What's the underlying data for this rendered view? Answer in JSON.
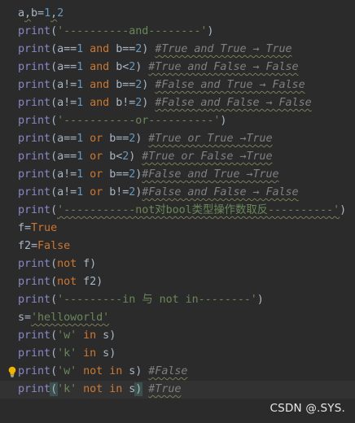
{
  "editor": {
    "lines": [
      {
        "tokens": [
          {
            "t": "plain",
            "v": "a"
          },
          {
            "t": "plain",
            "v": ",",
            "sq": true
          },
          {
            "t": "plain",
            "v": "b="
          },
          {
            "t": "num",
            "v": "1"
          },
          {
            "t": "plain",
            "v": ",",
            "sq": true
          },
          {
            "t": "num",
            "v": "2"
          }
        ]
      },
      {
        "tokens": [
          {
            "t": "builtin",
            "v": "print"
          },
          {
            "t": "plain",
            "v": "("
          },
          {
            "t": "str",
            "v": "'----------and--------'"
          },
          {
            "t": "plain",
            "v": ")"
          }
        ]
      },
      {
        "tokens": [
          {
            "t": "builtin",
            "v": "print"
          },
          {
            "t": "plain",
            "v": "(a=="
          },
          {
            "t": "num",
            "v": "1"
          },
          {
            "t": "plain",
            "v": " "
          },
          {
            "t": "kw",
            "v": "and"
          },
          {
            "t": "plain",
            "v": " b=="
          },
          {
            "t": "num",
            "v": "2"
          },
          {
            "t": "plain",
            "v": ")"
          },
          {
            "t": "plain",
            "v": " "
          },
          {
            "t": "comment",
            "v": "#True and True → True",
            "sq": true
          }
        ]
      },
      {
        "tokens": [
          {
            "t": "builtin",
            "v": "print"
          },
          {
            "t": "plain",
            "v": "(a=="
          },
          {
            "t": "num",
            "v": "1"
          },
          {
            "t": "plain",
            "v": " "
          },
          {
            "t": "kw",
            "v": "and"
          },
          {
            "t": "plain",
            "v": " b<"
          },
          {
            "t": "num",
            "v": "2"
          },
          {
            "t": "plain",
            "v": ")"
          },
          {
            "t": "plain",
            "v": " "
          },
          {
            "t": "comment",
            "v": "#True and False → False",
            "sq": true
          }
        ]
      },
      {
        "tokens": [
          {
            "t": "builtin",
            "v": "print"
          },
          {
            "t": "plain",
            "v": "(a!="
          },
          {
            "t": "num",
            "v": "1"
          },
          {
            "t": "plain",
            "v": " "
          },
          {
            "t": "kw",
            "v": "and"
          },
          {
            "t": "plain",
            "v": " b=="
          },
          {
            "t": "num",
            "v": "2"
          },
          {
            "t": "plain",
            "v": ")"
          },
          {
            "t": "plain",
            "v": " "
          },
          {
            "t": "comment",
            "v": "#False and True → False",
            "sq": true
          }
        ]
      },
      {
        "tokens": [
          {
            "t": "builtin",
            "v": "print"
          },
          {
            "t": "plain",
            "v": "(a!="
          },
          {
            "t": "num",
            "v": "1"
          },
          {
            "t": "plain",
            "v": " "
          },
          {
            "t": "kw",
            "v": "and"
          },
          {
            "t": "plain",
            "v": " b!="
          },
          {
            "t": "num",
            "v": "2"
          },
          {
            "t": "plain",
            "v": ")"
          },
          {
            "t": "plain",
            "v": " "
          },
          {
            "t": "comment",
            "v": "#False and False → False",
            "sq": true
          }
        ]
      },
      {
        "tokens": [
          {
            "t": "builtin",
            "v": "print"
          },
          {
            "t": "plain",
            "v": "("
          },
          {
            "t": "str",
            "v": "'-----------or----------'"
          },
          {
            "t": "plain",
            "v": ")"
          }
        ]
      },
      {
        "tokens": [
          {
            "t": "builtin",
            "v": "print"
          },
          {
            "t": "plain",
            "v": "(a=="
          },
          {
            "t": "num",
            "v": "1"
          },
          {
            "t": "plain",
            "v": " "
          },
          {
            "t": "kw",
            "v": "or"
          },
          {
            "t": "plain",
            "v": " b=="
          },
          {
            "t": "num",
            "v": "2"
          },
          {
            "t": "plain",
            "v": ")"
          },
          {
            "t": "plain",
            "v": " "
          },
          {
            "t": "comment",
            "v": "#True or True →True",
            "sq": true
          }
        ]
      },
      {
        "tokens": [
          {
            "t": "builtin",
            "v": "print"
          },
          {
            "t": "plain",
            "v": "(a=="
          },
          {
            "t": "num",
            "v": "1"
          },
          {
            "t": "plain",
            "v": " "
          },
          {
            "t": "kw",
            "v": "or"
          },
          {
            "t": "plain",
            "v": " b<"
          },
          {
            "t": "num",
            "v": "2"
          },
          {
            "t": "plain",
            "v": ")"
          },
          {
            "t": "plain",
            "v": " "
          },
          {
            "t": "comment",
            "v": "#True or False →True",
            "sq": true
          }
        ]
      },
      {
        "tokens": [
          {
            "t": "builtin",
            "v": "print"
          },
          {
            "t": "plain",
            "v": "(a!="
          },
          {
            "t": "num",
            "v": "1"
          },
          {
            "t": "plain",
            "v": " "
          },
          {
            "t": "kw",
            "v": "or"
          },
          {
            "t": "plain",
            "v": " b=="
          },
          {
            "t": "num",
            "v": "2"
          },
          {
            "t": "plain",
            "v": ")"
          },
          {
            "t": "comment",
            "v": "#False and True →True",
            "sq": true
          }
        ]
      },
      {
        "tokens": [
          {
            "t": "builtin",
            "v": "print"
          },
          {
            "t": "plain",
            "v": "(a!="
          },
          {
            "t": "num",
            "v": "1"
          },
          {
            "t": "plain",
            "v": " "
          },
          {
            "t": "kw",
            "v": "or"
          },
          {
            "t": "plain",
            "v": " b!="
          },
          {
            "t": "num",
            "v": "2"
          },
          {
            "t": "plain",
            "v": ")"
          },
          {
            "t": "comment",
            "v": "#False and False → False",
            "sq": true
          }
        ]
      },
      {
        "tokens": [
          {
            "t": "builtin",
            "v": "print"
          },
          {
            "t": "plain",
            "v": "("
          },
          {
            "t": "str",
            "v": "'-----------not对bool类型操作数取反----------'",
            "sq": true
          },
          {
            "t": "plain",
            "v": ")"
          }
        ]
      },
      {
        "tokens": [
          {
            "t": "plain",
            "v": "f="
          },
          {
            "t": "kw",
            "v": "True"
          }
        ]
      },
      {
        "tokens": [
          {
            "t": "plain",
            "v": "f2="
          },
          {
            "t": "kw",
            "v": "False"
          }
        ]
      },
      {
        "tokens": [
          {
            "t": "builtin",
            "v": "print"
          },
          {
            "t": "plain",
            "v": "("
          },
          {
            "t": "kw",
            "v": "not"
          },
          {
            "t": "plain",
            "v": " f)"
          }
        ]
      },
      {
        "tokens": [
          {
            "t": "builtin",
            "v": "print"
          },
          {
            "t": "plain",
            "v": "("
          },
          {
            "t": "kw",
            "v": "not"
          },
          {
            "t": "plain",
            "v": " f2)"
          }
        ]
      },
      {
        "tokens": [
          {
            "t": "builtin",
            "v": "print"
          },
          {
            "t": "plain",
            "v": "("
          },
          {
            "t": "str",
            "v": "'---------in 与 not in--------'"
          },
          {
            "t": "plain",
            "v": ")"
          }
        ]
      },
      {
        "tokens": [
          {
            "t": "plain",
            "v": "s="
          },
          {
            "t": "str",
            "v": "'helloworld'",
            "sq": true
          }
        ]
      },
      {
        "tokens": [
          {
            "t": "builtin",
            "v": "print"
          },
          {
            "t": "plain",
            "v": "("
          },
          {
            "t": "str",
            "v": "'w'"
          },
          {
            "t": "plain",
            "v": " "
          },
          {
            "t": "kw",
            "v": "in"
          },
          {
            "t": "plain",
            "v": " s)"
          }
        ]
      },
      {
        "tokens": [
          {
            "t": "builtin",
            "v": "print"
          },
          {
            "t": "plain",
            "v": "("
          },
          {
            "t": "str",
            "v": "'k'"
          },
          {
            "t": "plain",
            "v": " "
          },
          {
            "t": "kw",
            "v": "in"
          },
          {
            "t": "plain",
            "v": " s)"
          }
        ]
      },
      {
        "tokens": [
          {
            "t": "builtin",
            "v": "print"
          },
          {
            "t": "plain",
            "v": "("
          },
          {
            "t": "str",
            "v": "'w'"
          },
          {
            "t": "plain",
            "v": " "
          },
          {
            "t": "kw",
            "v": "not"
          },
          {
            "t": "plain",
            "v": " "
          },
          {
            "t": "kw",
            "v": "in"
          },
          {
            "t": "plain",
            "v": " s)"
          },
          {
            "t": "plain",
            "v": " "
          },
          {
            "t": "comment",
            "v": "#False",
            "sq": true
          }
        ]
      },
      {
        "current": true,
        "tokens": [
          {
            "t": "builtin",
            "v": "print"
          },
          {
            "t": "paren-hl",
            "v": "("
          },
          {
            "t": "str",
            "v": "'k'"
          },
          {
            "t": "plain",
            "v": " "
          },
          {
            "t": "kw",
            "v": "not"
          },
          {
            "t": "plain",
            "v": " "
          },
          {
            "t": "kw",
            "v": "in"
          },
          {
            "t": "plain",
            "v": " s"
          },
          {
            "t": "paren-hl",
            "v": ")"
          },
          {
            "t": "plain",
            "v": " "
          },
          {
            "t": "comment",
            "v": "#True",
            "sq": true
          }
        ]
      }
    ]
  },
  "intention_bulb": {
    "icon": "lightbulb-icon",
    "color": "#f0b400"
  },
  "watermark": {
    "text": "CSDN @.SYS."
  },
  "colors": {
    "background": "#2b2b2b",
    "current_line": "#323232",
    "builtin": "#8888c6",
    "keyword": "#cc7832",
    "number": "#6897bb",
    "string": "#6a8759",
    "comment": "#808080",
    "plain": "#a9b7c6"
  }
}
